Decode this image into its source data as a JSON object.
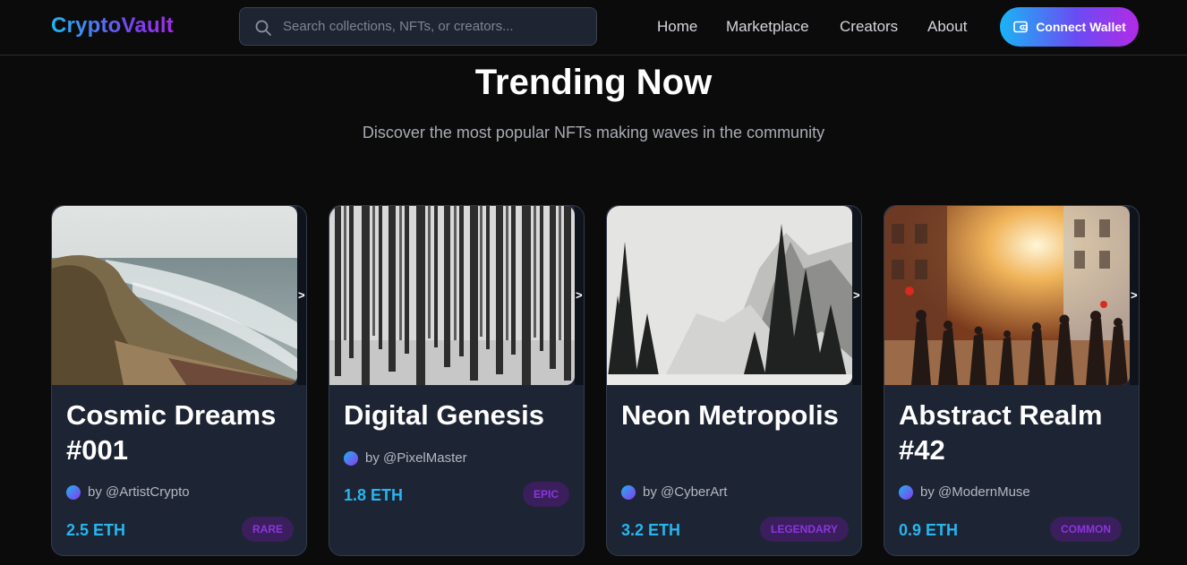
{
  "header": {
    "logo": "CryptoVault",
    "search_placeholder": "Search collections, NFTs, or creators...",
    "nav": [
      "Home",
      "Marketplace",
      "Creators",
      "About"
    ],
    "connect_label": "Connect Wallet",
    "icons": {
      "search": "search-icon",
      "wallet": "wallet-icon"
    }
  },
  "hero": {
    "title": "Trending Now",
    "subtitle": "Discover the most popular NFTs making waves in the community"
  },
  "cards": [
    {
      "name": "Cosmic Dreams #001",
      "creator": "by @ArtistCrypto",
      "price": "2.5 ETH",
      "rarity": "RARE",
      "arrow": ">"
    },
    {
      "name": "Digital Genesis",
      "creator": "by @PixelMaster",
      "price": "1.8 ETH",
      "rarity": "EPIC",
      "arrow": ">"
    },
    {
      "name": "Neon Metropolis",
      "creator": "by @CyberArt",
      "price": "3.2 ETH",
      "rarity": "LEGENDARY",
      "arrow": ">"
    },
    {
      "name": "Abstract Realm #42",
      "creator": "by @ModernMuse",
      "price": "0.9 ETH",
      "rarity": "COMMON",
      "arrow": ">"
    }
  ],
  "colors": {
    "background": "#0b0b0c",
    "card": "#1d2433",
    "accent_blue": "#26b6f0",
    "accent_purple": "#8c35df"
  }
}
